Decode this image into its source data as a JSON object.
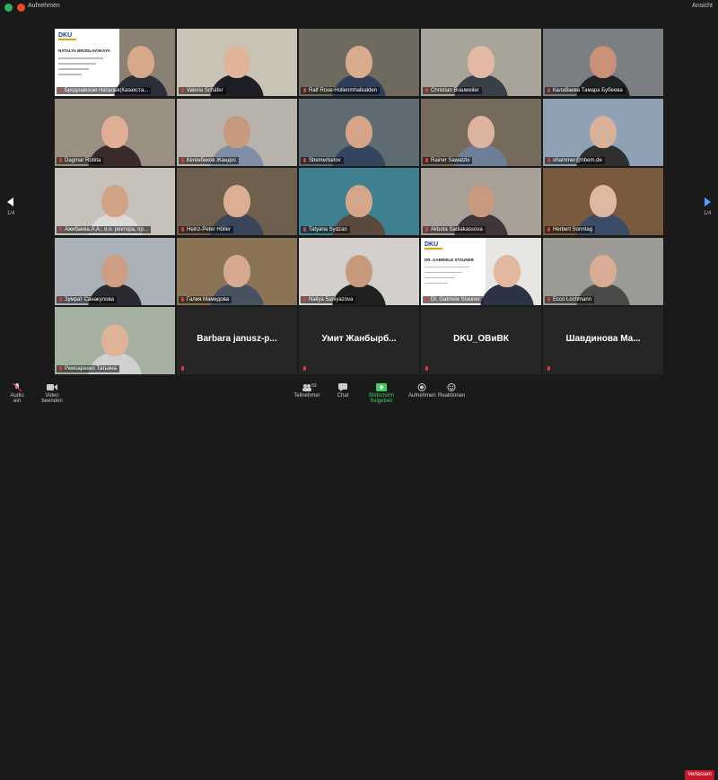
{
  "topbar": {
    "recording_label": "Aufnehmen",
    "view_label": "Ansicht"
  },
  "pager": {
    "left": "1/4",
    "right": "1/4"
  },
  "participants": [
    {
      "name": "Бродлавская Наталья(Казахста...",
      "slide": true,
      "slide_logo": "DKU",
      "slide_title": "NATALYA BRODLAVSKAYA"
    },
    {
      "name": "Valeria Schäfer"
    },
    {
      "name": "Ralf Rose-Hollenmhalkalden"
    },
    {
      "name": "Christian Brauweiler"
    },
    {
      "name": "Калабаева Тамара Бубеева"
    },
    {
      "name": "Dagmar Robita"
    },
    {
      "name": "Кегенбеков Жандос"
    },
    {
      "name": "Sbemerbetov"
    },
    {
      "name": "Rainer Sawatzki"
    },
    {
      "name": "ohammer@hbem.de"
    },
    {
      "name": "Ажибаева А.А., и.о. ректора, пр..."
    },
    {
      "name": "Heinz-Peter Höller"
    },
    {
      "name": "Tatyana Sydzan"
    },
    {
      "name": "Akbota Sadiakassova"
    },
    {
      "name": "Herbert Sonntag"
    },
    {
      "name": "Зумрат Санакулова"
    },
    {
      "name": "Галия Мамедова"
    },
    {
      "name": "Nailya Saniyazova"
    },
    {
      "name": "Dr. Gabriele Stauner",
      "slide": true,
      "slide_logo": "DKU",
      "slide_title": "DR. GABRIELE STAUNER"
    },
    {
      "name": "Ecco Lochmann"
    },
    {
      "name": "Ремоаренко Татьяна"
    },
    {
      "name": "Barbara janusz-p...",
      "blank": true
    },
    {
      "name": "Умит Жанбырб...",
      "blank": true
    },
    {
      "name": "DKU_ОВиВК",
      "blank": true
    },
    {
      "name": "Шавдинова Ма...",
      "blank": true
    }
  ],
  "toolbar": {
    "audio": "Audio ein",
    "video": "Video beenden",
    "participants": "Teilnehmer",
    "participants_count": "69",
    "chat": "Chat",
    "share": "Bildschirm freigeben",
    "record": "Aufnehmen",
    "reactions": "Reaktionen",
    "leave": "Verlassen"
  },
  "colors": {
    "share": "#3fce5f",
    "leave": "#c5162a",
    "muted": "#e23b3b",
    "next_arrow": "#4fa3ff"
  }
}
